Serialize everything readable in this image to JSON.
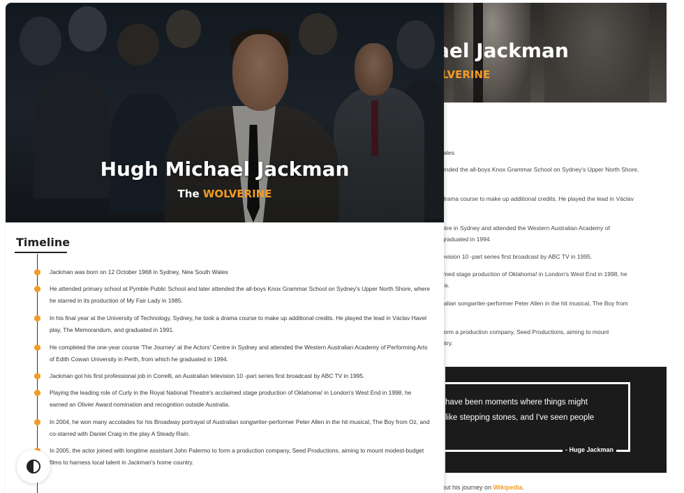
{
  "hero": {
    "name": "Hugh Michael Jackman",
    "subtitle_prefix": "The",
    "subtitle_accent": "WOLVERINE"
  },
  "back_hero": {
    "name_fragment": "ael Jackman",
    "subtitle_fragment": "LVERINE"
  },
  "back_lines": [
    "/ales",
    "ended the all-boys Knox Grammar School on Sydney's Upper North Shore,",
    "drama course to make up additional credits. He played the lead in Václav",
    "ntre in Sydney and attended the Western Australian Academy of",
    "graduated in 1994.",
    "evision 10 -part series first broadcast by ABC TV in 1995.",
    "imed stage production of Oklahoma! in London's West End in 1998, he",
    "lia.",
    "ralian songwriter-performer Peter Allen in the hit musical, The Boy from",
    "form a production company, Seed Productions, aiming to mount",
    "ntry."
  ],
  "quote": {
    "line1": "have been moments where things might",
    "line2": "like stepping stones, and I've seen people",
    "author": "- Huge Jackman"
  },
  "back_footer": {
    "text": "out his journey on",
    "link": "Wikipedia",
    "suffix": "."
  },
  "timeline": {
    "title": "Timeline",
    "items": [
      {
        "text": "Jackman was born on 12 October 1968 in Sydney, New South Wales"
      },
      {
        "text": "He attended primary school at Pymble Public School and later attended the all-boys Knox Grammar School on Sydney's Upper North Shore, where he starred in its production of My Fair Lady in 1985."
      },
      {
        "text": "In his final year at the University of Technology, Sydney, he took a drama course to make up additional credits. He played the lead in Václav Havel play, The Memorandum, and graduated in 1991."
      },
      {
        "text": "He completed the one-year course 'The Journey' at the Actors' Centre in Sydney and attended the Western Australian Academy of Performing Arts of Edith Cowan University in Perth, from which he graduated in 1994."
      },
      {
        "text": "Jackman got his first professional job in Correlli, an Australian television 10 -part series first broadcast by ABC TV in 1995."
      },
      {
        "text": "Playing the leading role of Curly in the Royal National Theatre's acclaimed stage production of Oklahoma! in London's West End in 1998, he earned an Olivier Award nomination and recognition outside Australia."
      },
      {
        "text": "In 2004, he won many accolades for his Broadway portrayal of Australian songwriter-performer Peter Allen in the hit musical, The Boy from Oz, and co-starred with Daniel Craig in the play A Steady Rain."
      },
      {
        "text": "In 2005, the actor joined with longtime assistant John Palermo to form a production company, Seed Productions, aiming to mount modest-budget films to harness local talent in Jackman's home country."
      }
    ]
  },
  "colors": {
    "accent": "#f39c24",
    "quote_bg": "#1b1b1b"
  },
  "icons": {
    "theme_toggle": "contrast-icon"
  }
}
